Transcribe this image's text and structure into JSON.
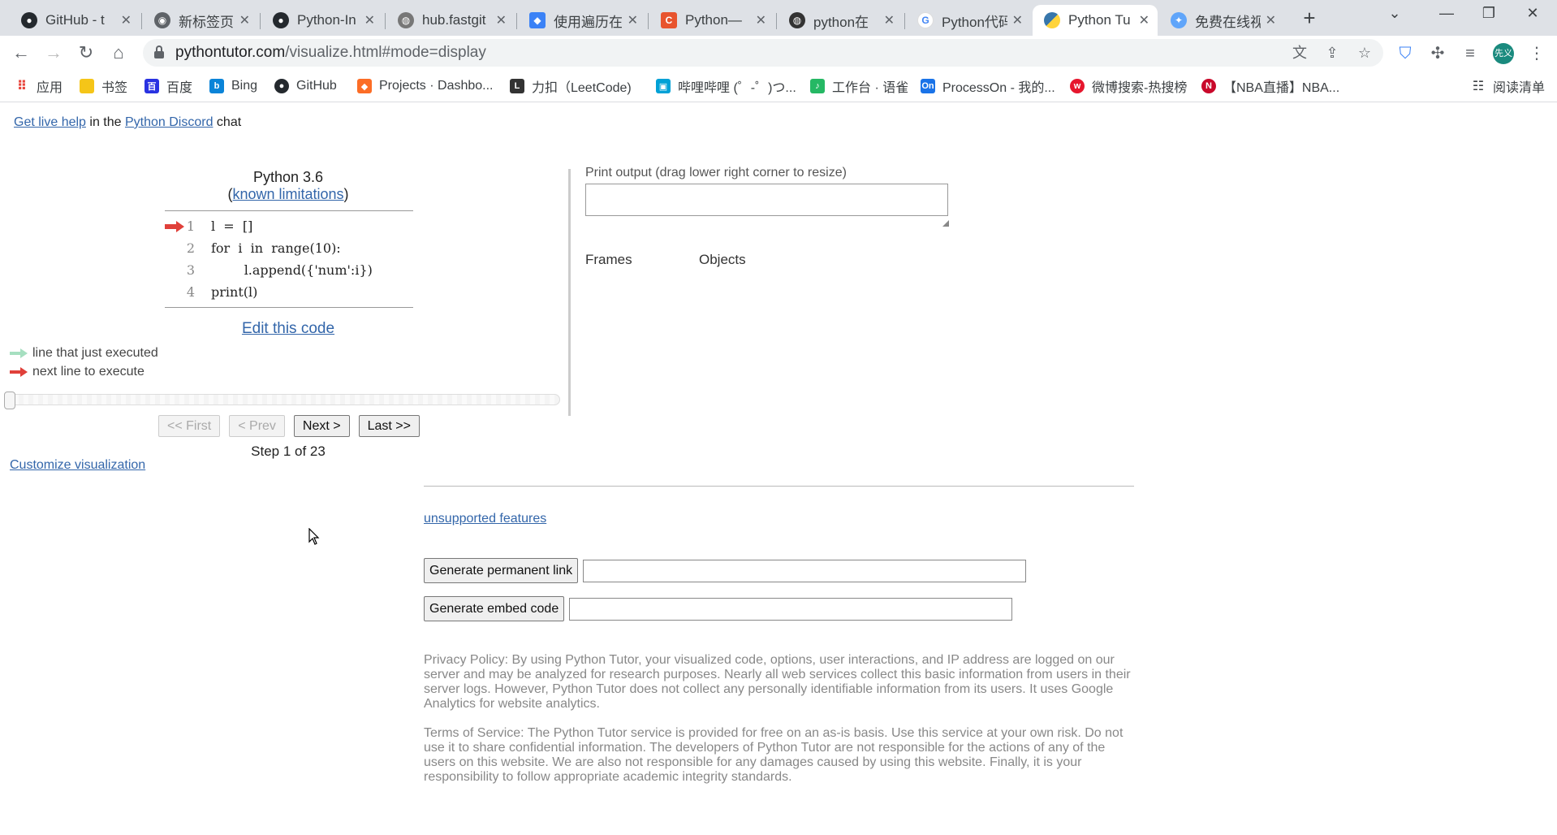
{
  "browser": {
    "tabs": [
      {
        "title": "GitHub - t",
        "favicon": "github-icon",
        "active": false
      },
      {
        "title": "新标签页",
        "favicon": "chrome-icon",
        "active": false
      },
      {
        "title": "Python-In",
        "favicon": "github-icon",
        "active": false
      },
      {
        "title": "hub.fastgit",
        "favicon": "globe-icon",
        "active": false
      },
      {
        "title": "使用遍历在",
        "favicon": "diamond-icon",
        "active": false
      },
      {
        "title": "Python—",
        "favicon": "csdn-icon",
        "active": false
      },
      {
        "title": "python在",
        "favicon": "globe-icon",
        "active": false
      },
      {
        "title": "Python代码",
        "favicon": "google-icon",
        "active": false
      },
      {
        "title": "Python Tu",
        "favicon": "python-icon",
        "active": true
      },
      {
        "title": "免费在线视",
        "favicon": "sparkle-icon",
        "active": false
      }
    ],
    "url_host": "pythontutor.com",
    "url_path": "/visualize.html#mode=display",
    "profile_initials": "先义",
    "bookmarks": [
      {
        "label": "应用",
        "icon": "apps-icon"
      },
      {
        "label": "书签",
        "icon": "folder-icon"
      },
      {
        "label": "百度",
        "icon": "baidu-icon"
      },
      {
        "label": "Bing",
        "icon": "bing-icon"
      },
      {
        "label": "GitHub",
        "icon": "github-icon"
      },
      {
        "label": "Projects · Dashbo...",
        "icon": "gitlab-icon"
      },
      {
        "label": "力扣（LeetCode)",
        "icon": "leetcode-icon"
      },
      {
        "label": "哔哩哔哩 (゜-゜)つ...",
        "icon": "bilibili-icon"
      },
      {
        "label": "工作台 · 语雀",
        "icon": "yuque-icon"
      },
      {
        "label": "ProcessOn - 我的...",
        "icon": "processon-icon"
      },
      {
        "label": "微博搜索-热搜榜",
        "icon": "weibo-icon"
      },
      {
        "label": "【NBA直播】NBA...",
        "icon": "nba-icon"
      }
    ],
    "reading_list": "阅读清单"
  },
  "page": {
    "help_prefix": "Get live help",
    "help_mid": " in the ",
    "help_link": "Python Discord",
    "help_suffix": " chat",
    "python_version": "Python 3.6",
    "limitations_open": "(",
    "limitations_link": "known limitations",
    "limitations_close": ")",
    "code_lines": [
      {
        "num": "1",
        "text": "l  =  []"
      },
      {
        "num": "2",
        "text": "for  i  in  range(10):"
      },
      {
        "num": "3",
        "text": "        l.append({'num':i})"
      },
      {
        "num": "4",
        "text": "print(l)"
      }
    ],
    "current_line": 1,
    "edit_code": "Edit this code",
    "legend_executed": "line that just executed",
    "legend_next": "next line to execute",
    "buttons": {
      "first": "<< First",
      "prev": "< Prev",
      "next": "Next >",
      "last": "Last >>"
    },
    "step_text": "Step 1 of 23",
    "slider_fraction": 0,
    "customize": "Customize visualization",
    "print_label": "Print output (drag lower right corner to resize)",
    "frames": "Frames",
    "objects": "Objects",
    "unsupported": "unsupported features",
    "gen_permalink": "Generate permanent link",
    "gen_embed": "Generate embed code",
    "privacy": "Privacy Policy: By using Python Tutor, your visualized code, options, user interactions, and IP address are logged on our server and may be analyzed for research purposes. Nearly all web services collect this basic information from users in their server logs. However, Python Tutor does not collect any personally identifiable information from its users. It uses Google Analytics for website analytics.",
    "terms": "Terms of Service: The Python Tutor service is provided for free on an as-is basis. Use this service at your own risk. Do not use it to share confidential information. The developers of Python Tutor are not responsible for the actions of any of the users on this website. We are also not responsible for any damages caused by using this website. Finally, it is your responsibility to follow appropriate academic integrity standards."
  },
  "colors": {
    "next_arrow": "#e0403a",
    "executed_arrow": "#a6dfc0",
    "link": "#3366aa"
  }
}
